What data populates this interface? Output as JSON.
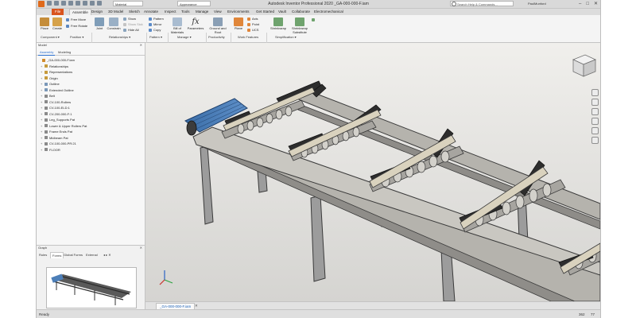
{
  "window": {
    "title": "Autodesk Inventor Professional 2020   _GA-000-000-F.iam",
    "search_placeholder": "Search Help & Commands...",
    "user": "PaulMunford",
    "qat_material": "Material",
    "qat_appearance": "Appearance"
  },
  "tabs": [
    "File",
    "Assemble",
    "Design",
    "3D Model",
    "Sketch",
    "Annotate",
    "Inspect",
    "Tools",
    "Manage",
    "View",
    "Environments",
    "Get Started",
    "Vault",
    "Collaborate",
    "Electromechanical"
  ],
  "ribbon": {
    "place": "Place",
    "create": "Create",
    "free_move": "Free Move",
    "free_rotate": "Free Rotate",
    "joint": "Joint",
    "constrain": "Constrain",
    "show": "Show",
    "show_sick": "Show Sick",
    "hide_all": "Hide All",
    "pattern": "Pattern",
    "mirror": "Mirror",
    "copy": "Copy",
    "bill_of_materials": "Bill of Materials",
    "parameters": "Parameters",
    "ground_and_root": "Ground and Root",
    "plane": "Plane",
    "axis": "Axis",
    "point": "Point",
    "ucs": "UCS",
    "shrinkwrap": "Shrinkwrap",
    "shrinkwrap_substitute": "Shrinkwrap Substitute",
    "panels": [
      "Component ▾",
      "Position ▾",
      "Relationships ▾",
      "Pattern ▾",
      "Manage ▾",
      "Productivity",
      "Work Features",
      "Simplification ▾"
    ]
  },
  "browser": {
    "title": "Model",
    "tabs": [
      "Assembly",
      "Modeling"
    ],
    "nodes": [
      {
        "label": "_GA-000-000-F.iam",
        "expand": "",
        "color": "#d08a2c"
      },
      {
        "label": "Relationships",
        "expand": "+",
        "color": "#c69a3c"
      },
      {
        "label": "Representations",
        "expand": "+",
        "color": "#c69a3c"
      },
      {
        "label": "Origin",
        "expand": "+",
        "color": "#c69a3c"
      },
      {
        "label": "Outline",
        "expand": "+",
        "color": "#7a98b8"
      },
      {
        "label": "Extended Outline",
        "expand": "+",
        "color": "#7a98b8"
      },
      {
        "label": "Belt",
        "expand": "+",
        "color": "#8a8a8a"
      },
      {
        "label": "CV-100-Rollers",
        "expand": "+",
        "color": "#8a8a8a"
      },
      {
        "label": "CV-100-ELD:1",
        "expand": "+",
        "color": "#8a8a8a"
      },
      {
        "label": "CV-200-000-F:1",
        "expand": "+",
        "color": "#8a8a8a"
      },
      {
        "label": "Leg_Supports Pat",
        "expand": "+",
        "color": "#8a8a8a"
      },
      {
        "label": "Lower & Upper Rollers Pat",
        "expand": "+",
        "color": "#8a8a8a"
      },
      {
        "label": "Frame Ends Pat",
        "expand": "+",
        "color": "#8a8a8a"
      },
      {
        "label": "Midbeam Pat",
        "expand": "+",
        "color": "#8a8a8a"
      },
      {
        "label": "CV-100-000-PR:21",
        "expand": "+",
        "color": "#8a8a8a"
      },
      {
        "label": "FLOOR",
        "expand": "+",
        "color": "#8a8a8a"
      }
    ]
  },
  "preview": {
    "title": "Graph",
    "tabs": [
      "Rules",
      "Forms",
      "Global Forms",
      "External"
    ]
  },
  "document_tab": "_GA-000-000-F.iam",
  "status": {
    "left": "Ready",
    "right1": "362",
    "right2": "77"
  }
}
